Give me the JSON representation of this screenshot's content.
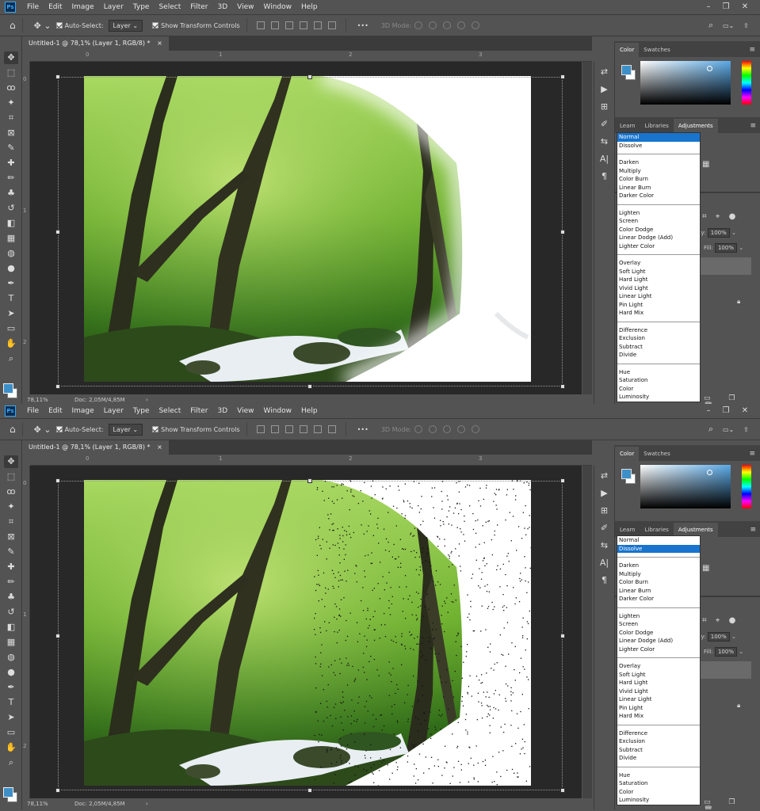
{
  "menu": {
    "logo": "Ps",
    "items": [
      "File",
      "Edit",
      "Image",
      "Layer",
      "Type",
      "Select",
      "Filter",
      "3D",
      "View",
      "Window",
      "Help"
    ]
  },
  "options": {
    "auto_select": "Auto-Select:",
    "auto_select_value": "Layer",
    "show_transform": "Show Transform Controls",
    "mode_3d": "3D Mode:",
    "more": "•••"
  },
  "document": {
    "tab": "Untitled-1 @ 78,1% (Layer 1, RGB/8) *",
    "zoom": "78,11%",
    "doc_info": "Doc: 2,05M/4,85M"
  },
  "ruler": {
    "h": [
      "0",
      "1",
      "2",
      "3"
    ],
    "v": [
      "0",
      "1",
      "2"
    ]
  },
  "panels": {
    "top_tabs": [
      "Color",
      "Swatches"
    ],
    "mid_tabs": [
      "Learn",
      "Libraries",
      "Adjustments"
    ],
    "opacity_label": "city:",
    "opacity": "100%",
    "fill_label": "Fill:",
    "fill": "100%"
  },
  "blend_modes": [
    [
      "Normal",
      "Dissolve"
    ],
    [
      "Darken",
      "Multiply",
      "Color Burn",
      "Linear Burn",
      "Darker Color"
    ],
    [
      "Lighten",
      "Screen",
      "Color Dodge",
      "Linear Dodge (Add)",
      "Lighter Color"
    ],
    [
      "Overlay",
      "Soft Light",
      "Hard Light",
      "Vivid Light",
      "Linear Light",
      "Pin Light",
      "Hard Mix"
    ],
    [
      "Difference",
      "Exclusion",
      "Subtract",
      "Divide"
    ],
    [
      "Hue",
      "Saturation",
      "Color",
      "Luminosity"
    ]
  ],
  "screens": [
    {
      "selected_mode": "Normal"
    },
    {
      "selected_mode": "Dissolve"
    }
  ],
  "colors": {
    "ui": "#535353",
    "panel_dark": "#3b3b3b",
    "selection": "#1874cd",
    "foreground": "#3d8fc8"
  },
  "icons": [
    "move-icon",
    "marquee-icon",
    "lasso-icon",
    "magic-wand-icon",
    "crop-icon",
    "frame-icon",
    "eyedropper-icon",
    "healing-icon",
    "brush-icon",
    "stamp-icon",
    "history-brush-icon",
    "eraser-icon",
    "gradient-icon",
    "blur-icon",
    "dodge-icon",
    "pen-icon",
    "type-icon",
    "path-select-icon",
    "rectangle-icon",
    "hand-icon",
    "zoom-icon"
  ]
}
